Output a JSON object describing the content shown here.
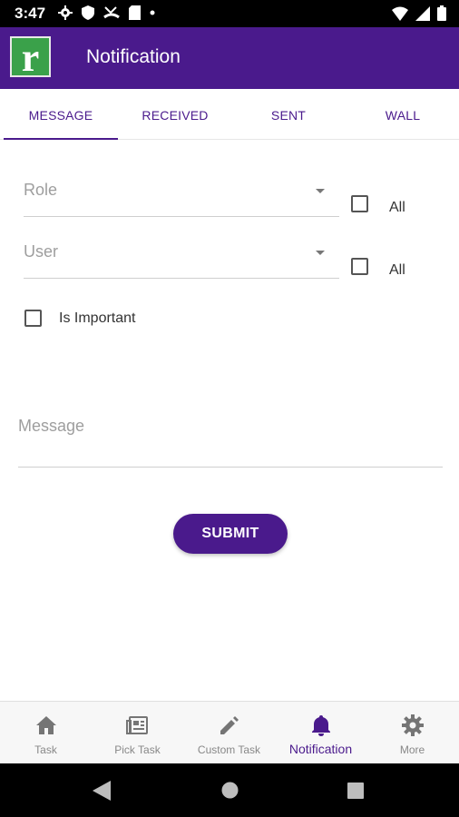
{
  "status_bar": {
    "time": "3:47",
    "icons_left": [
      "settings-icon",
      "shield-icon",
      "missed-call-icon",
      "sd-card-icon",
      "dot-icon"
    ],
    "icons_right": [
      "wifi-icon",
      "signal-icon",
      "battery-icon"
    ]
  },
  "app_bar": {
    "logo_letter": "r",
    "title": "Notification",
    "color": "#4a1a8c"
  },
  "tabs": [
    {
      "label": "MESSAGE",
      "active": true
    },
    {
      "label": "RECEIVED",
      "active": false
    },
    {
      "label": "SENT",
      "active": false
    },
    {
      "label": "WALL",
      "active": false
    }
  ],
  "form": {
    "role": {
      "placeholder": "Role",
      "all_label": "All"
    },
    "user": {
      "placeholder": "User",
      "all_label": "All"
    },
    "important_label": "Is Important",
    "message_placeholder": "Message",
    "submit_label": "SUBMIT"
  },
  "bottom_nav": [
    {
      "label": "Task",
      "icon": "home-icon",
      "active": false
    },
    {
      "label": "Pick Task",
      "icon": "newspaper-icon",
      "active": false
    },
    {
      "label": "Custom Task",
      "icon": "pencil-icon",
      "active": false
    },
    {
      "label": "Notification",
      "icon": "bell-icon",
      "active": true
    },
    {
      "label": "More",
      "icon": "gear-icon",
      "active": false
    }
  ],
  "system_nav": [
    "back-icon",
    "home-circle-icon",
    "recents-icon"
  ]
}
